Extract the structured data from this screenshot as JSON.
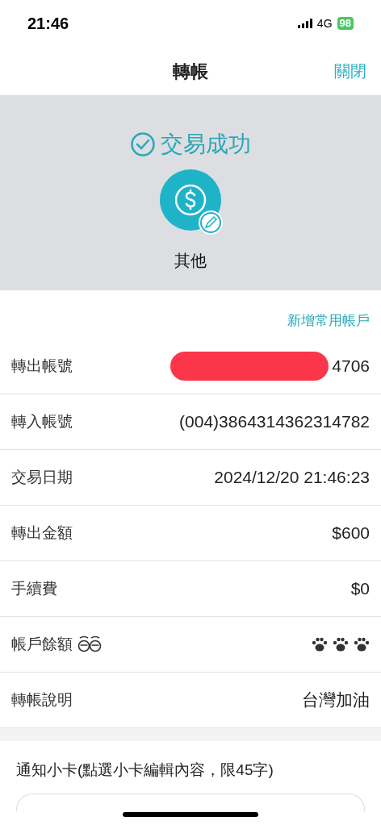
{
  "status_bar": {
    "time": "21:46",
    "network": "4G",
    "battery": "98"
  },
  "header": {
    "title": "轉帳",
    "close": "關閉"
  },
  "result": {
    "status": "交易成功",
    "category": "其他"
  },
  "add_account": "新增常用帳戶",
  "rows": [
    {
      "kind": "redacted",
      "label": "轉出帳號",
      "value": "4706"
    },
    {
      "kind": "text",
      "label": "轉入帳號",
      "value": "(004)3864314362314782"
    },
    {
      "kind": "text",
      "label": "交易日期",
      "value": "2024/12/20 21:46:23"
    },
    {
      "kind": "text",
      "label": "轉出金額",
      "value": "$600"
    },
    {
      "kind": "text",
      "label": "手續費",
      "value": "$0"
    },
    {
      "kind": "masked",
      "label": "帳戶餘額"
    },
    {
      "kind": "text",
      "label": "轉帳說明",
      "value": "台灣加油"
    }
  ],
  "card": {
    "title": "通知小卡(點選小卡編輯內容，限45字)"
  }
}
